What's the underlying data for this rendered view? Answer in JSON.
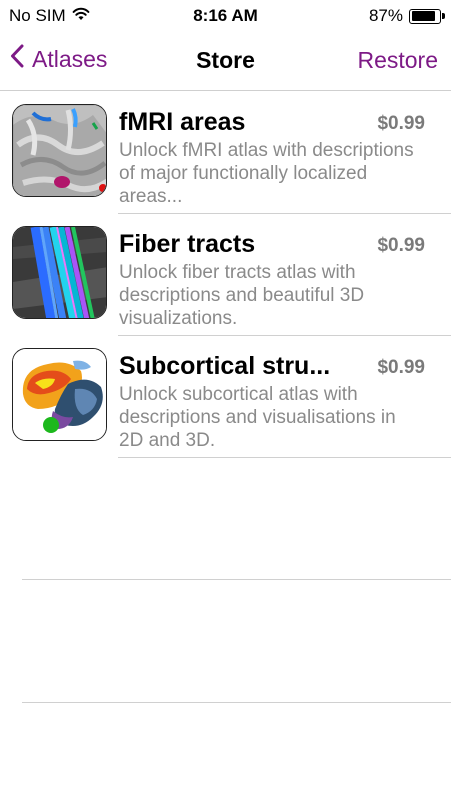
{
  "status": {
    "carrier": "No SIM",
    "time": "8:16 AM",
    "battery_percent": "87%",
    "battery_level": 0.87
  },
  "nav": {
    "back_label": "Atlases",
    "title": "Store",
    "restore_label": "Restore",
    "accent_color": "#7d1a86"
  },
  "items": [
    {
      "title": "fMRI areas",
      "price": "$0.99",
      "description": "Unlock fMRI atlas with descriptions of major functionally localized areas..."
    },
    {
      "title": "Fiber tracts",
      "price": "$0.99",
      "description": "Unlock fiber tracts atlas with descriptions and beautiful 3D visualizations."
    },
    {
      "title": "Subcortical stru...",
      "price": "$0.99",
      "description": "Unlock subcortical atlas with descriptions and visualisations in 2D and 3D."
    }
  ]
}
